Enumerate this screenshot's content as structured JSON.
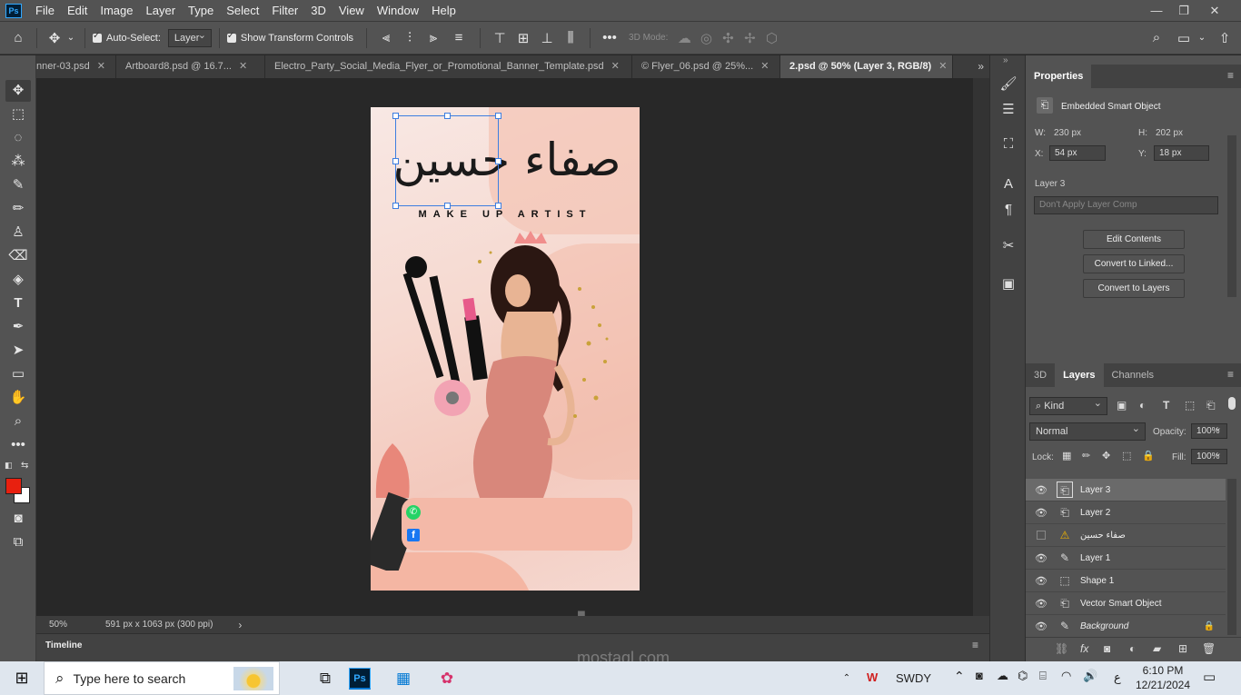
{
  "menu": [
    "File",
    "Edit",
    "Image",
    "Layer",
    "Type",
    "Select",
    "Filter",
    "3D",
    "View",
    "Window",
    "Help"
  ],
  "app_logo": "Ps",
  "options": {
    "auto_select_label": "Auto-Select:",
    "auto_select_value": "Layer",
    "transform_label": "Show Transform Controls",
    "mode3d_label": "3D Mode:"
  },
  "tabs": [
    {
      "label": "nner-03.psd"
    },
    {
      "label": "Artboard8.psd @ 16.7..."
    },
    {
      "label": "Electro_Party_Social_Media_Flyer_or_Promotional_Banner_Template.psd"
    },
    {
      "label": "© Flyer_06.psd @ 25%..."
    },
    {
      "label": "2.psd @ 50% (Layer 3, RGB/8)"
    }
  ],
  "tab_close": "✕",
  "artboard": {
    "calligraphy": "صفاء حسين",
    "subtitle": "MAKE UP ARTIST"
  },
  "status": {
    "zoom": "50%",
    "doc_info": "591 px x 1063 px (300 ppi)"
  },
  "timeline_label": "Timeline",
  "properties": {
    "title": "Properties",
    "type_label": "Embedded Smart Object",
    "w_label": "W:",
    "w_value": "230 px",
    "h_label": "H:",
    "h_value": "202 px",
    "x_label": "X:",
    "x_value": "54 px",
    "y_label": "Y:",
    "y_value": "18 px",
    "layer_name": "Layer 3",
    "comp_placeholder": "Don't Apply Layer Comp",
    "btn_edit": "Edit Contents",
    "btn_linked": "Convert to Linked...",
    "btn_layers": "Convert to Layers"
  },
  "layers_panel": {
    "tabs": [
      "3D",
      "Layers",
      "Channels"
    ],
    "kind": "Kind",
    "blend": "Normal",
    "opacity_label": "Opacity:",
    "opacity_value": "100%",
    "lock_label": "Lock:",
    "fill_label": "Fill:",
    "fill_value": "100%",
    "layers": [
      {
        "name": "Layer 3",
        "icon": "smart-object-icon",
        "visible": true,
        "selected": true
      },
      {
        "name": "Layer 2",
        "icon": "smart-object-icon",
        "visible": true,
        "selected": false
      },
      {
        "name": "صفاء حسين",
        "icon": "warning-icon",
        "visible": false,
        "selected": false
      },
      {
        "name": "Layer 1",
        "icon": "brush-icon",
        "visible": true,
        "selected": false
      },
      {
        "name": "Shape 1",
        "icon": "shape-icon",
        "visible": true,
        "selected": false
      },
      {
        "name": "Vector Smart Object",
        "icon": "smart-object-icon",
        "visible": true,
        "selected": false
      },
      {
        "name": "Background",
        "icon": "brush-icon",
        "visible": true,
        "selected": false,
        "locked": true
      }
    ]
  },
  "taskbar": {
    "search_placeholder": "Type here to search",
    "tray_label": "SWDY",
    "ime_char": "ع",
    "time": "6:10 PM",
    "date": "12/21/2024"
  },
  "watermark": {
    "arabic": "مستقل",
    "latin": "mostaql.com"
  },
  "colors": {
    "foreground": "#e8200f",
    "background": "#ffffff",
    "accent": "#31a8ff"
  }
}
